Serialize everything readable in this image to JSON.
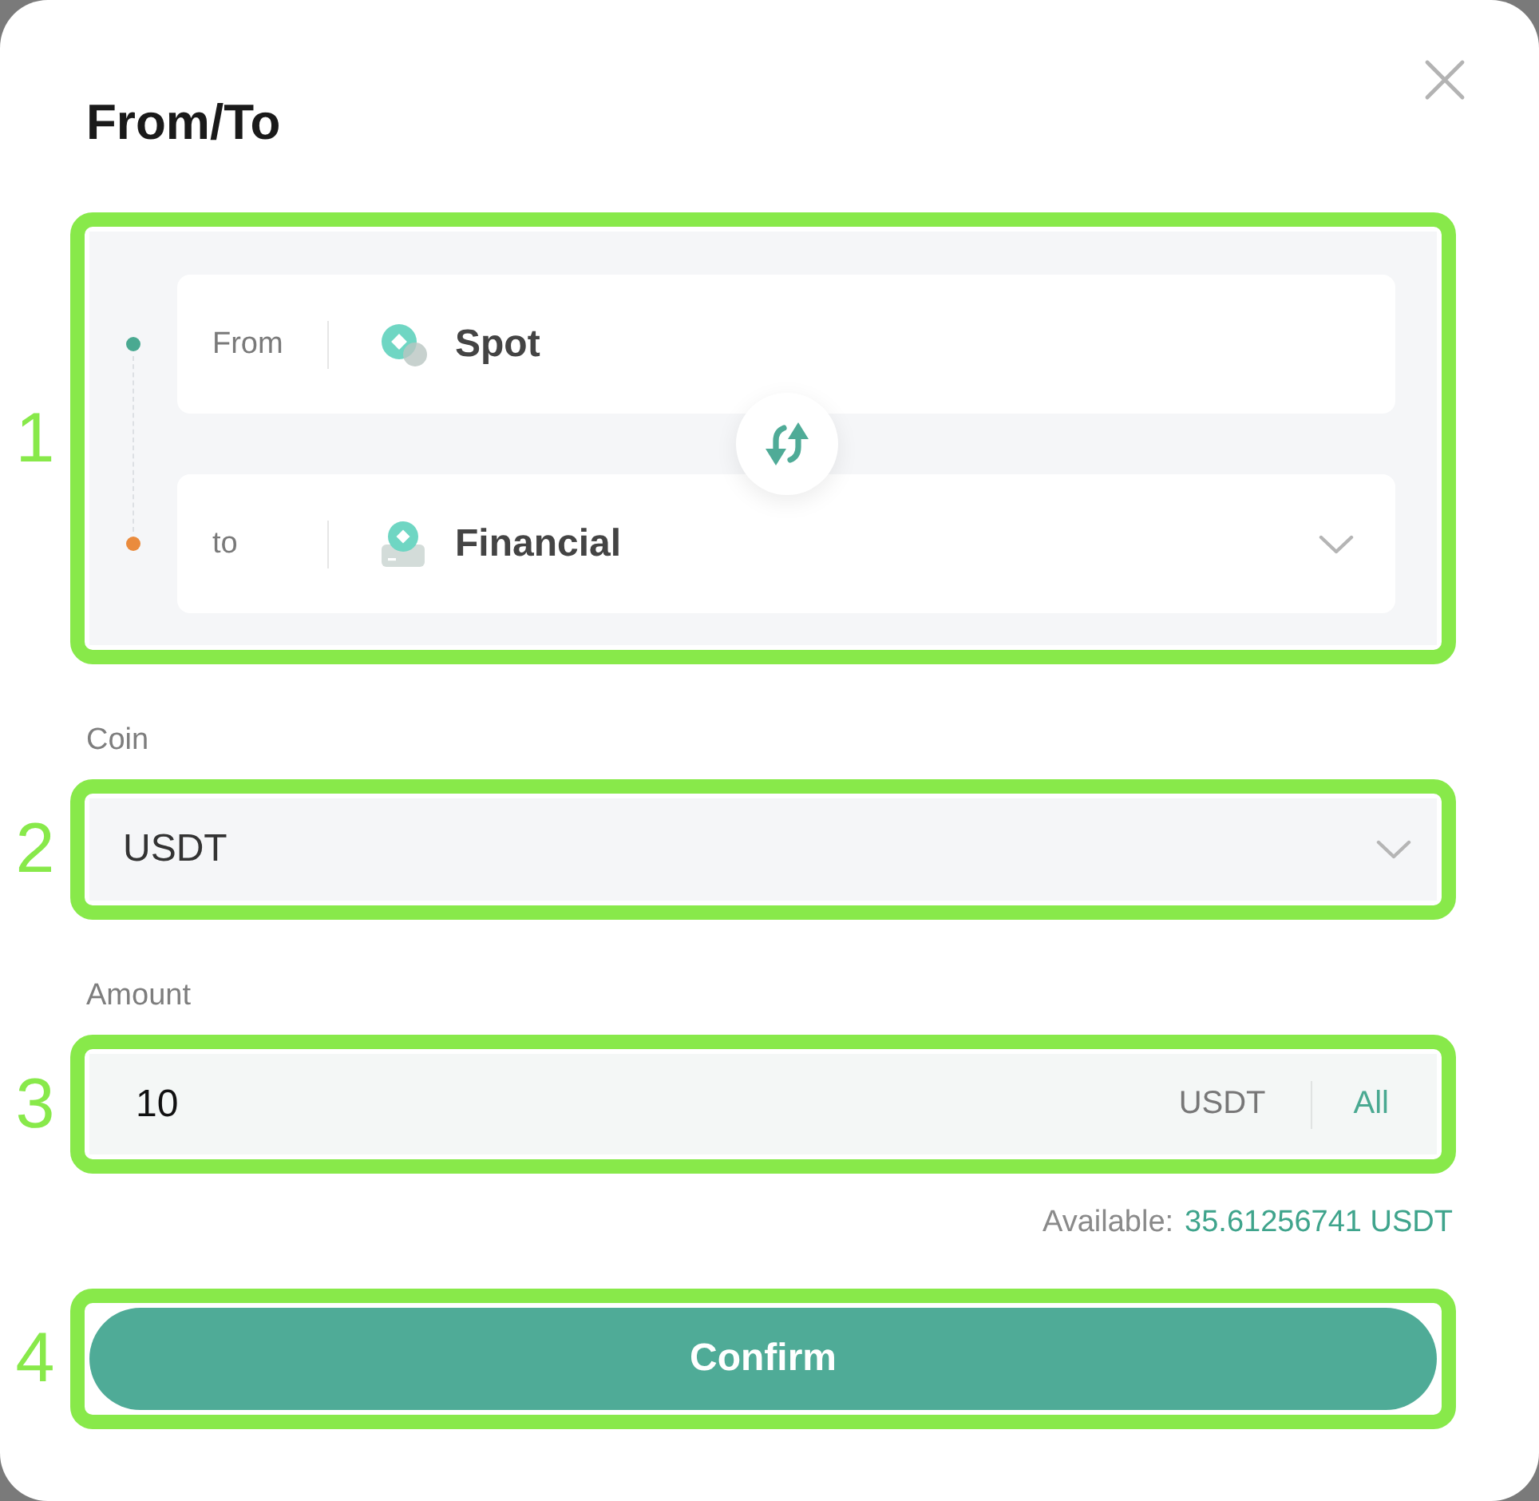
{
  "dialog": {
    "title": "From/To"
  },
  "transfer": {
    "callout": "1",
    "accounts": [
      {
        "label": "From",
        "name": "Spot",
        "kind": "spot",
        "color": "#4aa991",
        "dropdown": false
      },
      {
        "label": "to",
        "name": "Financial",
        "kind": "financial",
        "color": "#ea8b3d",
        "dropdown": true
      }
    ]
  },
  "coin": {
    "label": "Coin",
    "callout": "2",
    "value": "USDT"
  },
  "amount": {
    "label": "Amount",
    "callout": "3",
    "value": "10",
    "unit": "USDT",
    "all_button": "All"
  },
  "available": {
    "label": "Available:",
    "value": "35.61256741 USDT"
  },
  "confirm": {
    "callout": "4",
    "label": "Confirm"
  }
}
